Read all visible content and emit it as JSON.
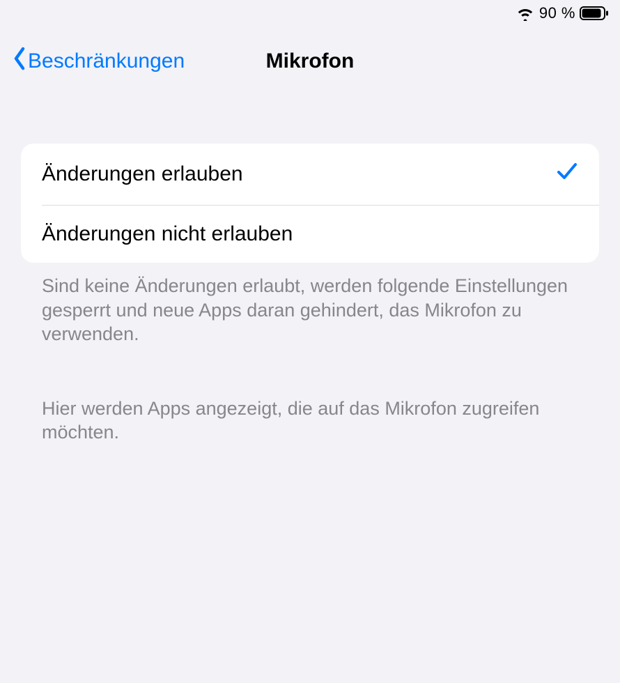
{
  "status": {
    "battery_percent_text": "90 %"
  },
  "nav": {
    "back_label": "Beschränkungen",
    "title": "Mikrofon"
  },
  "options": {
    "allow": {
      "label": "Änderungen erlauben",
      "selected": true
    },
    "disallow": {
      "label": "Änderungen nicht erlauben",
      "selected": false
    }
  },
  "footer": {
    "explain1": "Sind keine Änderungen erlaubt, werden folgende Einstellungen gesperrt und neue Apps daran gehindert, das Mikrofon zu verwenden.",
    "explain2": "Hier werden Apps angezeigt, die auf das Mikrofon zugreifen möchten."
  },
  "colors": {
    "accent": "#007aff",
    "background": "#f2f2f7",
    "cell_bg": "#ffffff",
    "secondary_text": "#86868b"
  }
}
